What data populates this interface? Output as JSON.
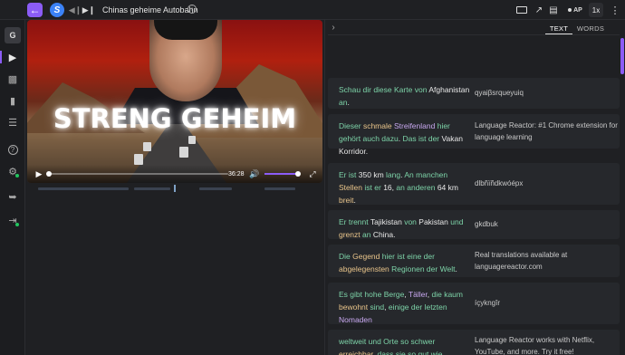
{
  "header": {
    "title": "Chinas geheime Autobahn",
    "ap_label": "AP",
    "speed_label": "1x"
  },
  "sidebar": {
    "avatar_letter": "G"
  },
  "video": {
    "headline": "STRENG GEHEIM",
    "time": "36:28"
  },
  "tabs": {
    "text": "TEXT",
    "words": "WORDS"
  },
  "colors": {
    "accent": "#8b5cf6",
    "word_green": "#7dd3a8",
    "word_purple": "#c8a8f0",
    "word_orange": "#e8c48a"
  },
  "rows": [
    {
      "original": [
        {
          "t": "Schau",
          "c": "g"
        },
        {
          "t": " "
        },
        {
          "t": "dir",
          "c": "g"
        },
        {
          "t": " "
        },
        {
          "t": "diese",
          "c": "g"
        },
        {
          "t": " "
        },
        {
          "t": "Karte",
          "c": "g"
        },
        {
          "t": " "
        },
        {
          "t": "von",
          "c": "g"
        },
        {
          "t": " "
        },
        {
          "t": "Afghanistan",
          "c": "w"
        },
        {
          "t": " "
        },
        {
          "t": "an",
          "c": "g"
        },
        {
          "t": "."
        }
      ],
      "translation": "qyaiβsrqueyuiq"
    },
    {
      "original": [
        {
          "t": "Dieser",
          "c": "g"
        },
        {
          "t": " "
        },
        {
          "t": "schmale",
          "c": "o"
        },
        {
          "t": " "
        },
        {
          "t": "Streifenland",
          "c": "p"
        },
        {
          "t": " "
        },
        {
          "t": "hier",
          "c": "g"
        },
        {
          "t": " "
        },
        {
          "t": "gehört",
          "c": "g"
        },
        {
          "t": " "
        },
        {
          "t": "auch",
          "c": "g"
        },
        {
          "t": " "
        },
        {
          "t": "dazu",
          "c": "g"
        },
        {
          "t": ". "
        },
        {
          "t": "Das",
          "c": "g"
        },
        {
          "t": " "
        },
        {
          "t": "ist",
          "c": "g"
        },
        {
          "t": " "
        },
        {
          "t": "der",
          "c": "g"
        },
        {
          "t": " "
        },
        {
          "t": "Vakan",
          "c": "w"
        },
        {
          "t": " "
        },
        {
          "t": "Korridor",
          "c": "w"
        },
        {
          "t": "."
        }
      ],
      "translation": "Language Reactor: #1 Chrome extension for language learning"
    },
    {
      "original": [
        {
          "t": "Er",
          "c": "g"
        },
        {
          "t": " "
        },
        {
          "t": "ist",
          "c": "g"
        },
        {
          "t": " "
        },
        {
          "t": "350",
          "c": "w"
        },
        {
          "t": " "
        },
        {
          "t": "km",
          "c": "w"
        },
        {
          "t": " "
        },
        {
          "t": "lang",
          "c": "g"
        },
        {
          "t": ". "
        },
        {
          "t": "An",
          "c": "g"
        },
        {
          "t": " "
        },
        {
          "t": "manchen",
          "c": "g"
        },
        {
          "t": " "
        },
        {
          "t": "Stellen",
          "c": "o"
        },
        {
          "t": " "
        },
        {
          "t": "ist",
          "c": "g"
        },
        {
          "t": " "
        },
        {
          "t": "er",
          "c": "g"
        },
        {
          "t": " "
        },
        {
          "t": "16",
          "c": "w"
        },
        {
          "t": ", "
        },
        {
          "t": "an",
          "c": "g"
        },
        {
          "t": " "
        },
        {
          "t": "anderen",
          "c": "g"
        },
        {
          "t": " "
        },
        {
          "t": "64",
          "c": "w"
        },
        {
          "t": " "
        },
        {
          "t": "km",
          "c": "w"
        },
        {
          "t": " "
        },
        {
          "t": "breit",
          "c": "o"
        },
        {
          "t": "."
        }
      ],
      "translation": "dlbñïñdkwóépx"
    },
    {
      "original": [
        {
          "t": "Er",
          "c": "g"
        },
        {
          "t": " "
        },
        {
          "t": "trennt",
          "c": "g"
        },
        {
          "t": " "
        },
        {
          "t": "Tajikistan",
          "c": "w"
        },
        {
          "t": " "
        },
        {
          "t": "von",
          "c": "g"
        },
        {
          "t": " "
        },
        {
          "t": "Pakistan",
          "c": "w"
        },
        {
          "t": " "
        },
        {
          "t": "und",
          "c": "g"
        },
        {
          "t": " "
        },
        {
          "t": "grenzt",
          "c": "o"
        },
        {
          "t": " "
        },
        {
          "t": "an",
          "c": "g"
        },
        {
          "t": " "
        },
        {
          "t": "China",
          "c": "w"
        },
        {
          "t": "."
        }
      ],
      "translation": "gkdbuk"
    },
    {
      "original": [
        {
          "t": "Die",
          "c": "g"
        },
        {
          "t": " "
        },
        {
          "t": "Gegend",
          "c": "o"
        },
        {
          "t": " "
        },
        {
          "t": "hier",
          "c": "g"
        },
        {
          "t": " "
        },
        {
          "t": "ist",
          "c": "g"
        },
        {
          "t": " "
        },
        {
          "t": "eine",
          "c": "g"
        },
        {
          "t": " "
        },
        {
          "t": "der",
          "c": "g"
        },
        {
          "t": " "
        },
        {
          "t": "abgelegensten",
          "c": "o"
        },
        {
          "t": " "
        },
        {
          "t": "Regionen",
          "c": "g"
        },
        {
          "t": " "
        },
        {
          "t": "der",
          "c": "g"
        },
        {
          "t": " "
        },
        {
          "t": "Welt",
          "c": "g"
        },
        {
          "t": "."
        }
      ],
      "translation": "Real translations available at languagereactor.com"
    },
    {
      "original": [
        {
          "t": "Es",
          "c": "g"
        },
        {
          "t": " "
        },
        {
          "t": "gibt",
          "c": "g"
        },
        {
          "t": " "
        },
        {
          "t": "hohe",
          "c": "g"
        },
        {
          "t": " "
        },
        {
          "t": "Berge",
          "c": "g"
        },
        {
          "t": ", "
        },
        {
          "t": "Täller",
          "c": "p"
        },
        {
          "t": ", "
        },
        {
          "t": "die",
          "c": "g"
        },
        {
          "t": " "
        },
        {
          "t": "kaum",
          "c": "g"
        },
        {
          "t": " "
        },
        {
          "t": "bewohnt",
          "c": "o"
        },
        {
          "t": " "
        },
        {
          "t": "sind",
          "c": "g"
        },
        {
          "t": ", "
        },
        {
          "t": "einige",
          "c": "g"
        },
        {
          "t": " "
        },
        {
          "t": "der",
          "c": "g"
        },
        {
          "t": " "
        },
        {
          "t": "letzten",
          "c": "g"
        },
        {
          "t": " "
        },
        {
          "t": "Nomaden",
          "c": "p"
        }
      ],
      "translation": "íçykngîr"
    },
    {
      "original": [
        {
          "t": "weltweit",
          "c": "g"
        },
        {
          "t": " "
        },
        {
          "t": "und",
          "c": "g"
        },
        {
          "t": " "
        },
        {
          "t": "Orte",
          "c": "g"
        },
        {
          "t": " "
        },
        {
          "t": "so",
          "c": "g"
        },
        {
          "t": " "
        },
        {
          "t": "schwer",
          "c": "g"
        },
        {
          "t": " "
        },
        {
          "t": "erreichbar",
          "c": "o"
        },
        {
          "t": ", "
        },
        {
          "t": "dass",
          "c": "g"
        },
        {
          "t": " "
        },
        {
          "t": "sie",
          "c": "g"
        },
        {
          "t": " "
        },
        {
          "t": "so",
          "c": "g"
        },
        {
          "t": " "
        },
        {
          "t": "gut",
          "c": "g"
        },
        {
          "t": " "
        },
        {
          "t": "wie",
          "c": "g"
        }
      ],
      "translation": "Language Reactor works with Netflix, YouTube, and more. Try it free!"
    }
  ]
}
